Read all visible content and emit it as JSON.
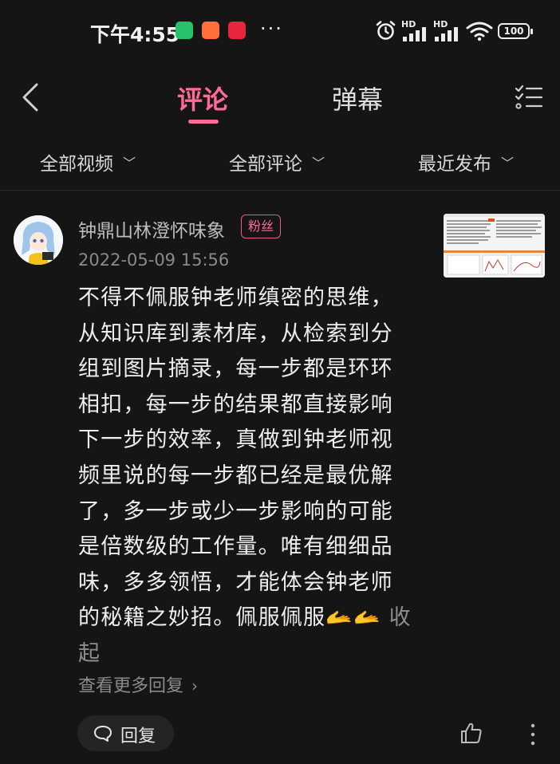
{
  "status_bar": {
    "time": "下午4:55",
    "more": "···",
    "signal1": "HD",
    "signal2": "HD",
    "battery": "100"
  },
  "header": {
    "tabs": [
      {
        "label": "评论",
        "active": true
      },
      {
        "label": "弹幕",
        "active": false
      }
    ],
    "accent": "#ff6b97"
  },
  "filters": [
    {
      "label": "全部视频"
    },
    {
      "label": "全部评论"
    },
    {
      "label": "最近发布"
    }
  ],
  "comment": {
    "username": "钟鼎山林澄怀味象",
    "badge": "粉丝",
    "timestamp": "2022-05-09 15:56",
    "text": "不得不佩服钟老师缜密的思维，从知识库到素材库，从检索到分组到图片摘录，每一步都是环环相扣，每一步的结果都直接影响下一步的效率，真做到钟老师视频里说的每一步都已经是最优解了，多一步或少一步影响的可能是倍数级的工作量。唯有细细品味，多多领悟，才能体会钟老师的秘籍之妙招。佩服佩服",
    "emoji": "🫴🫴",
    "collapse_label": "收起",
    "more_replies_label": "查看更多回复",
    "more_replies_arrow": "›",
    "reply_label": "回复"
  }
}
